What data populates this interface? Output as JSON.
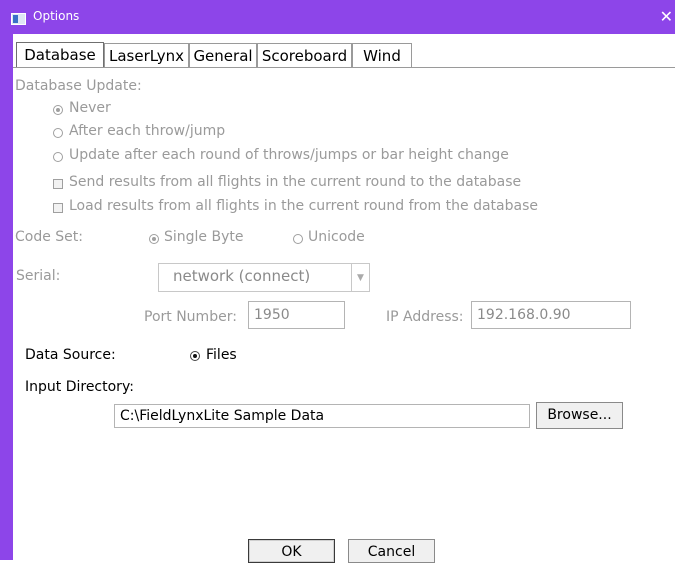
{
  "window": {
    "title": "Options",
    "close_glyph": "✕"
  },
  "tabs": [
    {
      "label": "Database",
      "active": true
    },
    {
      "label": "LaserLynx",
      "active": false
    },
    {
      "label": "General",
      "active": false
    },
    {
      "label": "Scoreboard",
      "active": false
    },
    {
      "label": "Wind",
      "active": false
    }
  ],
  "database_update": {
    "heading": "Database Update:",
    "selected": "Never",
    "radio_options": [
      "Never",
      "After each throw/jump",
      "Update after each round of throws/jumps or bar height change"
    ],
    "checkboxes": [
      {
        "label": "Send results from all flights in the current round to the database",
        "checked": false
      },
      {
        "label": "Load results from all flights in the current round from the database",
        "checked": false
      }
    ]
  },
  "code_set": {
    "label": "Code Set:",
    "options": [
      "Single Byte",
      "Unicode"
    ],
    "selected": "Single Byte"
  },
  "serial": {
    "label": "Serial:",
    "selected": "network (connect)",
    "port_label": "Port Number:",
    "port_value": "1950",
    "ip_label": "IP Address:",
    "ip_value": "192.168.0.90"
  },
  "data_source": {
    "label": "Data Source:",
    "option": "Files",
    "selected": true
  },
  "input_directory": {
    "label": "Input Directory:",
    "value": "C:\\FieldLynxLite Sample Data",
    "browse_label": "Browse..."
  },
  "buttons": {
    "ok": "OK",
    "cancel": "Cancel"
  },
  "colors": {
    "titlebar": "#8d45e9",
    "disabled_text": "#9a9a9a"
  },
  "icons": [
    "window-icon",
    "close-icon",
    "combo-arrow-icon"
  ]
}
